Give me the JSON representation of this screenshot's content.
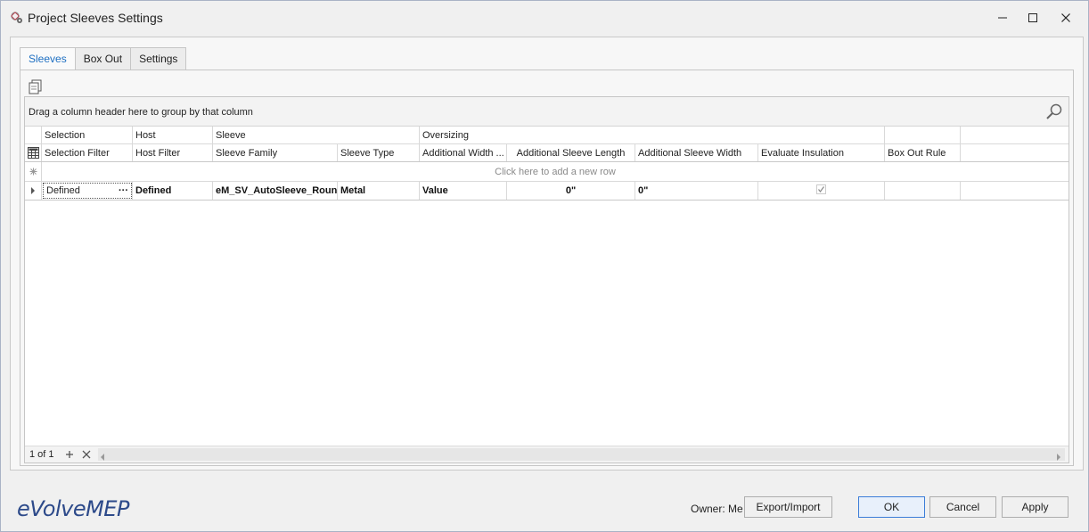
{
  "window": {
    "title": "Project Sleeves Settings"
  },
  "tabs": [
    {
      "label": "Sleeves",
      "active": true
    },
    {
      "label": "Box Out",
      "active": false
    },
    {
      "label": "Settings",
      "active": false
    }
  ],
  "grid": {
    "group_hint": "Drag a column header here to group by that column",
    "bands": [
      "Selection",
      "Host",
      "Sleeve",
      "Oversizing"
    ],
    "columns": [
      "Selection Filter",
      "Host Filter",
      "Sleeve Family",
      "Sleeve Type",
      "Additional Width ...",
      "Additional Sleeve Length",
      "Additional Sleeve Width",
      "Evaluate Insulation",
      "Box Out Rule"
    ],
    "new_row_text": "Click here to add a new row",
    "row": {
      "selection_filter": "Defined",
      "ellipsis": "···",
      "host_filter": "Defined",
      "sleeve_family": "eM_SV_AutoSleeve_Round",
      "sleeve_type": "Metal",
      "additional_width": "Value",
      "additional_sleeve_length": "0\"",
      "additional_sleeve_width": "0\"",
      "evaluate_insulation_checked": true,
      "box_out_rule": ""
    },
    "navigator": {
      "page_info": "1 of 1"
    }
  },
  "footer": {
    "logo": "eVolveMEP",
    "owner": "Owner: Me",
    "buttons": {
      "export_import": "Export/Import",
      "ok": "OK",
      "cancel": "Cancel",
      "apply": "Apply"
    }
  },
  "colors": {
    "accent": "#1e6fc2",
    "logo": "#2d4a8a",
    "ok_border": "#3b7dd8"
  }
}
